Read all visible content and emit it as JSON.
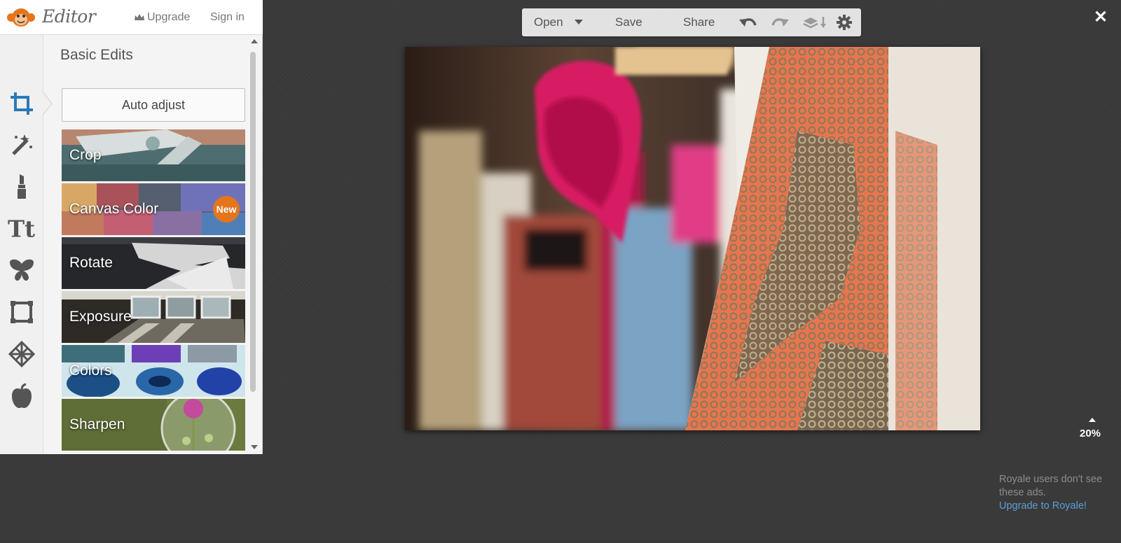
{
  "app": {
    "title": "Editor",
    "upgrade_label": "Upgrade",
    "signin_label": "Sign in"
  },
  "panel": {
    "section_title": "Basic Edits",
    "auto_adjust_label": "Auto adjust",
    "rail_icons": [
      "crop-icon",
      "magic-wand-icon",
      "lipstick-icon",
      "text-icon",
      "butterfly-icon",
      "frame-icon",
      "texture-icon",
      "apple-icon"
    ],
    "tools": [
      {
        "label": "Crop",
        "badge": ""
      },
      {
        "label": "Canvas Color",
        "badge": "New"
      },
      {
        "label": "Rotate",
        "badge": ""
      },
      {
        "label": "Exposure",
        "badge": ""
      },
      {
        "label": "Colors",
        "badge": ""
      },
      {
        "label": "Sharpen",
        "badge": ""
      }
    ]
  },
  "toolbar": {
    "open_label": "Open",
    "save_label": "Save",
    "share_label": "Share",
    "icons": [
      "undo-icon",
      "redo-icon",
      "layers-icon",
      "settings-icon"
    ]
  },
  "canvas": {
    "zoom_label": "20%"
  },
  "ad": {
    "text": "Royale users don't see these ads.",
    "link": "Upgrade to Royale!"
  },
  "colors": {
    "accent_badge": "#e4751d",
    "link": "#5b9fd6",
    "background": "#3c3c3c"
  }
}
